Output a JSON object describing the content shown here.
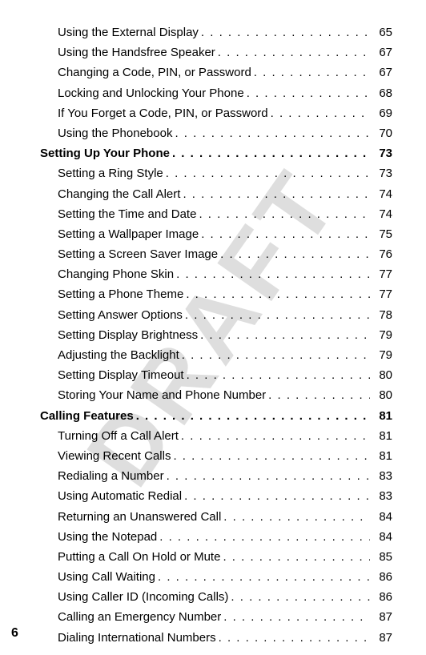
{
  "watermark": "DRAFT",
  "page_number": "6",
  "toc": [
    {
      "label": "Using the External Display",
      "page": "65",
      "type": "sub"
    },
    {
      "label": "Using the Handsfree Speaker",
      "page": "67",
      "type": "sub"
    },
    {
      "label": "Changing a Code, PIN, or Password",
      "page": "67",
      "type": "sub"
    },
    {
      "label": "Locking and Unlocking Your Phone",
      "page": "68",
      "type": "sub"
    },
    {
      "label": "If You Forget a Code, PIN, or Password",
      "page": "69",
      "type": "sub"
    },
    {
      "label": "Using the Phonebook",
      "page": "70",
      "type": "sub"
    },
    {
      "label": "Setting Up Your Phone",
      "page": "73",
      "type": "section"
    },
    {
      "label": "Setting a Ring Style",
      "page": "73",
      "type": "sub"
    },
    {
      "label": "Changing the Call Alert",
      "page": "74",
      "type": "sub"
    },
    {
      "label": "Setting the Time and Date",
      "page": "74",
      "type": "sub"
    },
    {
      "label": "Setting a Wallpaper Image",
      "page": "75",
      "type": "sub"
    },
    {
      "label": "Setting a Screen Saver Image",
      "page": "76",
      "type": "sub"
    },
    {
      "label": "Changing Phone Skin",
      "page": "77",
      "type": "sub"
    },
    {
      "label": "Setting a Phone Theme",
      "page": "77",
      "type": "sub"
    },
    {
      "label": "Setting Answer Options",
      "page": "78",
      "type": "sub"
    },
    {
      "label": "Setting Display Brightness",
      "page": "79",
      "type": "sub"
    },
    {
      "label": "Adjusting the Backlight",
      "page": "79",
      "type": "sub"
    },
    {
      "label": "Setting Display Timeout",
      "page": "80",
      "type": "sub"
    },
    {
      "label": "Storing Your Name and Phone Number",
      "page": "80",
      "type": "sub"
    },
    {
      "label": "Calling Features",
      "page": "81",
      "type": "section"
    },
    {
      "label": "Turning Off a Call Alert",
      "page": "81",
      "type": "sub"
    },
    {
      "label": "Viewing Recent Calls",
      "page": "81",
      "type": "sub"
    },
    {
      "label": "Redialing a Number",
      "page": "83",
      "type": "sub"
    },
    {
      "label": "Using Automatic Redial",
      "page": "83",
      "type": "sub"
    },
    {
      "label": "Returning an Unanswered Call",
      "page": "84",
      "type": "sub"
    },
    {
      "label": "Using the Notepad",
      "page": "84",
      "type": "sub"
    },
    {
      "label": "Putting a Call On Hold or Mute",
      "page": "85",
      "type": "sub"
    },
    {
      "label": "Using Call Waiting",
      "page": "86",
      "type": "sub"
    },
    {
      "label": "Using Caller ID (Incoming Calls)",
      "page": "86",
      "type": "sub"
    },
    {
      "label": "Calling an Emergency Number",
      "page": "87",
      "type": "sub"
    },
    {
      "label": "Dialing International Numbers",
      "page": "87",
      "type": "sub"
    }
  ]
}
